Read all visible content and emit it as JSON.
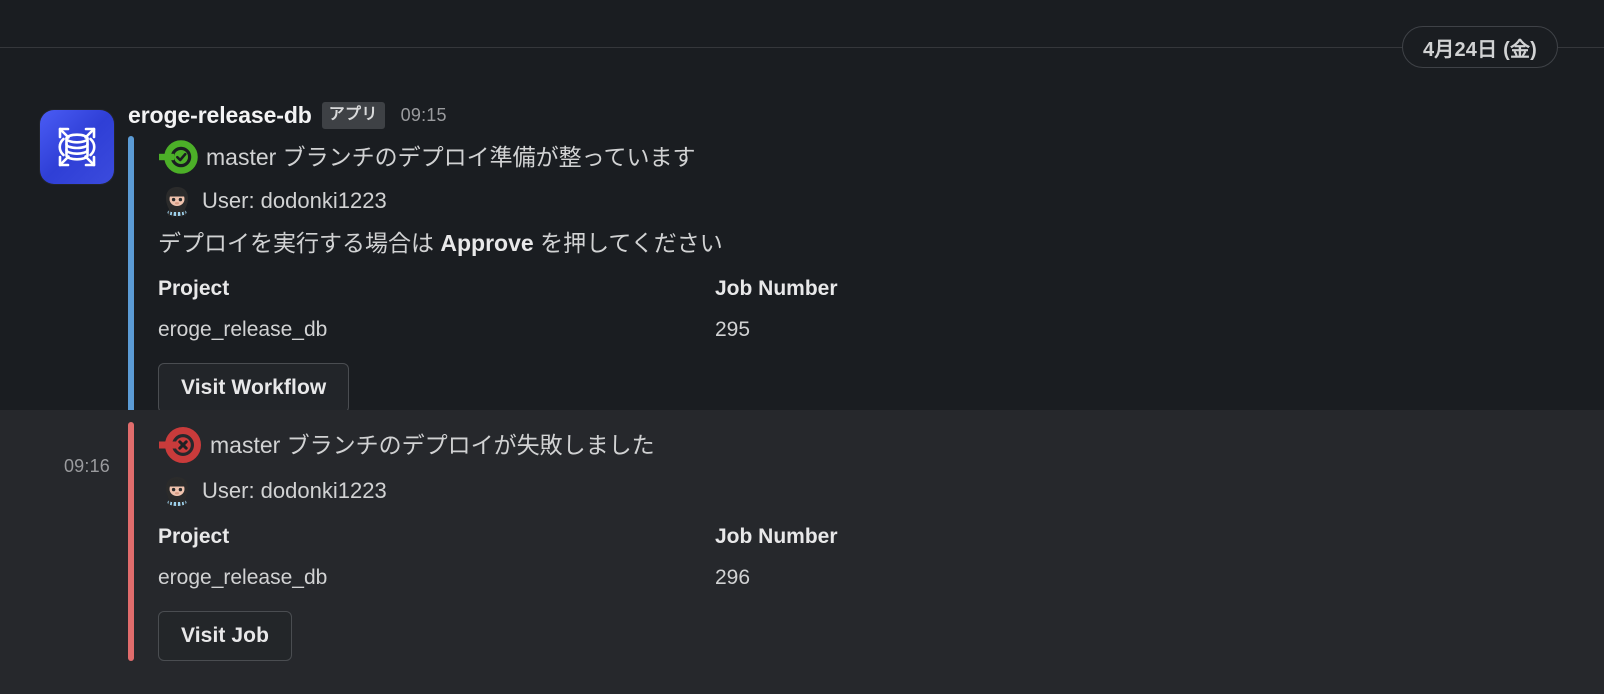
{
  "theme": {
    "background": "#1a1d21",
    "background_hover": "#26282c",
    "text_primary": "#d1d2d3",
    "text_muted": "#9a9b9e",
    "divider": "#35373b",
    "success_color": "#4caf28",
    "failure_color": "#c93b3b",
    "bar_blue": "#5b9bd5",
    "bar_red": "#e06c6c",
    "avatar_blue": "#3b4bdd"
  },
  "date_divider": {
    "label": "4月24日 (金)"
  },
  "messages": [
    {
      "author": "eroge-release-db",
      "badge": "アプリ",
      "time": "09:15",
      "avatar_icon": "database-expand-icon",
      "bar_color": "#5b9bd5",
      "status_icon": "circleci-success-icon",
      "title": "master ブランチのデプロイ準備が整っています",
      "user_icon": "octocat-icon",
      "user_line": "User: dodonki1223",
      "body_prefix": "デプロイを実行する場合は ",
      "body_bold": "Approve",
      "body_suffix": " を押してください",
      "fields": [
        {
          "title": "Project",
          "value": "eroge_release_db"
        },
        {
          "title": "Job Number",
          "value": "295"
        }
      ],
      "action_label": "Visit Workflow"
    },
    {
      "author": "eroge-release-db",
      "badge": "アプリ",
      "time": "09:16",
      "hover_time": "09:16",
      "bar_color": "#e06c6c",
      "status_icon": "circleci-failure-icon",
      "title": "master ブランチのデプロイが失敗しました",
      "user_icon": "octocat-icon",
      "user_line": "User: dodonki1223",
      "fields": [
        {
          "title": "Project",
          "value": "eroge_release_db"
        },
        {
          "title": "Job Number",
          "value": "296"
        }
      ],
      "action_label": "Visit Job"
    }
  ]
}
